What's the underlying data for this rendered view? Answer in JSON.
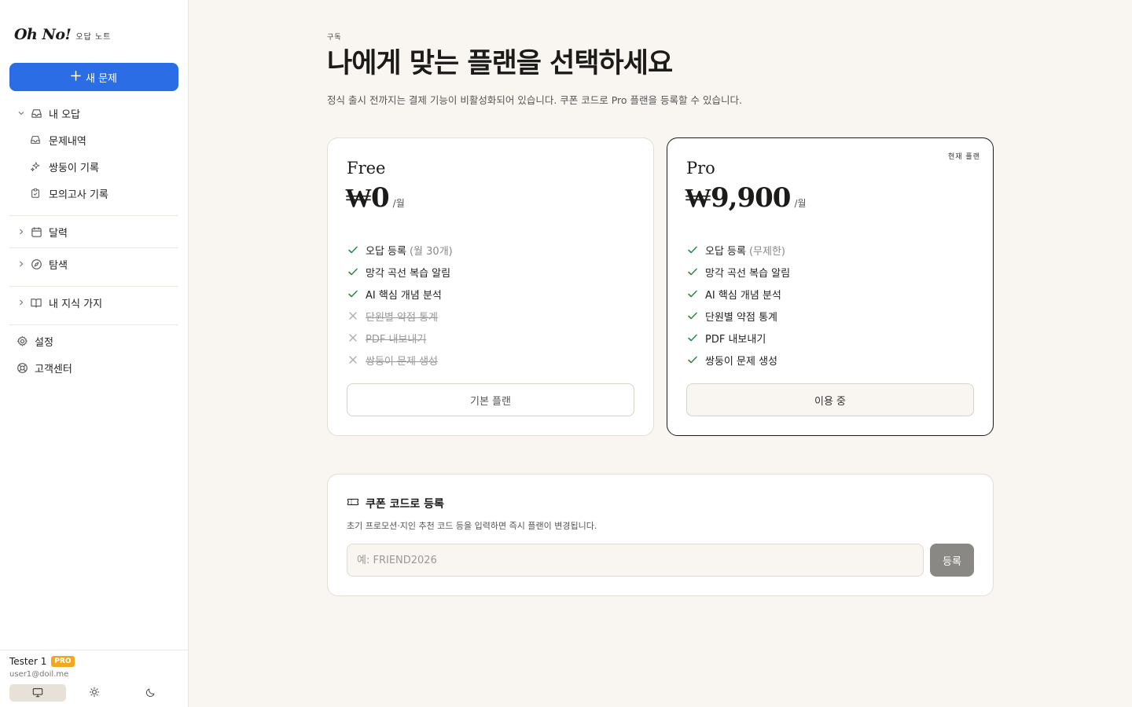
{
  "brand": {
    "name": "Oh No!",
    "sub": "오답 노트"
  },
  "sidebar": {
    "new_button": "새 문제",
    "my_wrong": "내 오답",
    "sub_items": [
      "문제내역",
      "쌍둥이 기록",
      "모의고사 기록"
    ],
    "calendar": "달력",
    "explore": "탐색",
    "knowledge": "내 지식 가지",
    "settings": "설정",
    "support": "고객센터"
  },
  "user": {
    "name": "Tester 1",
    "badge": "PRO",
    "email": "user1@doil.me"
  },
  "header": {
    "eyebrow": "구독",
    "title": "나에게 맞는 플랜을 선택하세요",
    "subtitle": "정식 출시 전까지는 결제 기능이 비활성화되어 있습니다. 쿠폰 코드로 Pro 플랜을 등록할 수 있습니다."
  },
  "plans": {
    "free": {
      "name": "Free",
      "price": "₩0",
      "unit": "/월",
      "features": [
        {
          "text": "오답 등록",
          "note": "(월 30개)",
          "included": true
        },
        {
          "text": "망각 곡선 복습 알림",
          "note": "",
          "included": true
        },
        {
          "text": "AI 핵심 개념 분석",
          "note": "",
          "included": true
        },
        {
          "text": "단원별 약점 통계",
          "note": "",
          "included": false
        },
        {
          "text": "PDF 내보내기",
          "note": "",
          "included": false
        },
        {
          "text": "쌍둥이 문제 생성",
          "note": "",
          "included": false
        }
      ],
      "button": "기본 플랜"
    },
    "pro": {
      "name": "Pro",
      "price": "₩9,900",
      "unit": "/월",
      "tag": "현재 플랜",
      "features": [
        {
          "text": "오답 등록",
          "note": "(무제한)",
          "included": true
        },
        {
          "text": "망각 곡선 복습 알림",
          "note": "",
          "included": true
        },
        {
          "text": "AI 핵심 개념 분석",
          "note": "",
          "included": true
        },
        {
          "text": "단원별 약점 통계",
          "note": "",
          "included": true
        },
        {
          "text": "PDF 내보내기",
          "note": "",
          "included": true
        },
        {
          "text": "쌍둥이 문제 생성",
          "note": "",
          "included": true
        }
      ],
      "button": "이용 중"
    }
  },
  "coupon": {
    "title": "쿠폰 코드로 등록",
    "desc": "초기 프로모션·지인 추천 코드 등을 입력하면 즉시 플랜이 변경됩니다.",
    "placeholder": "예: FRIEND2026",
    "button": "등록"
  },
  "colors": {
    "accent": "#2b6de5",
    "check": "#2f8a4a",
    "badge": "#f0a81c"
  }
}
